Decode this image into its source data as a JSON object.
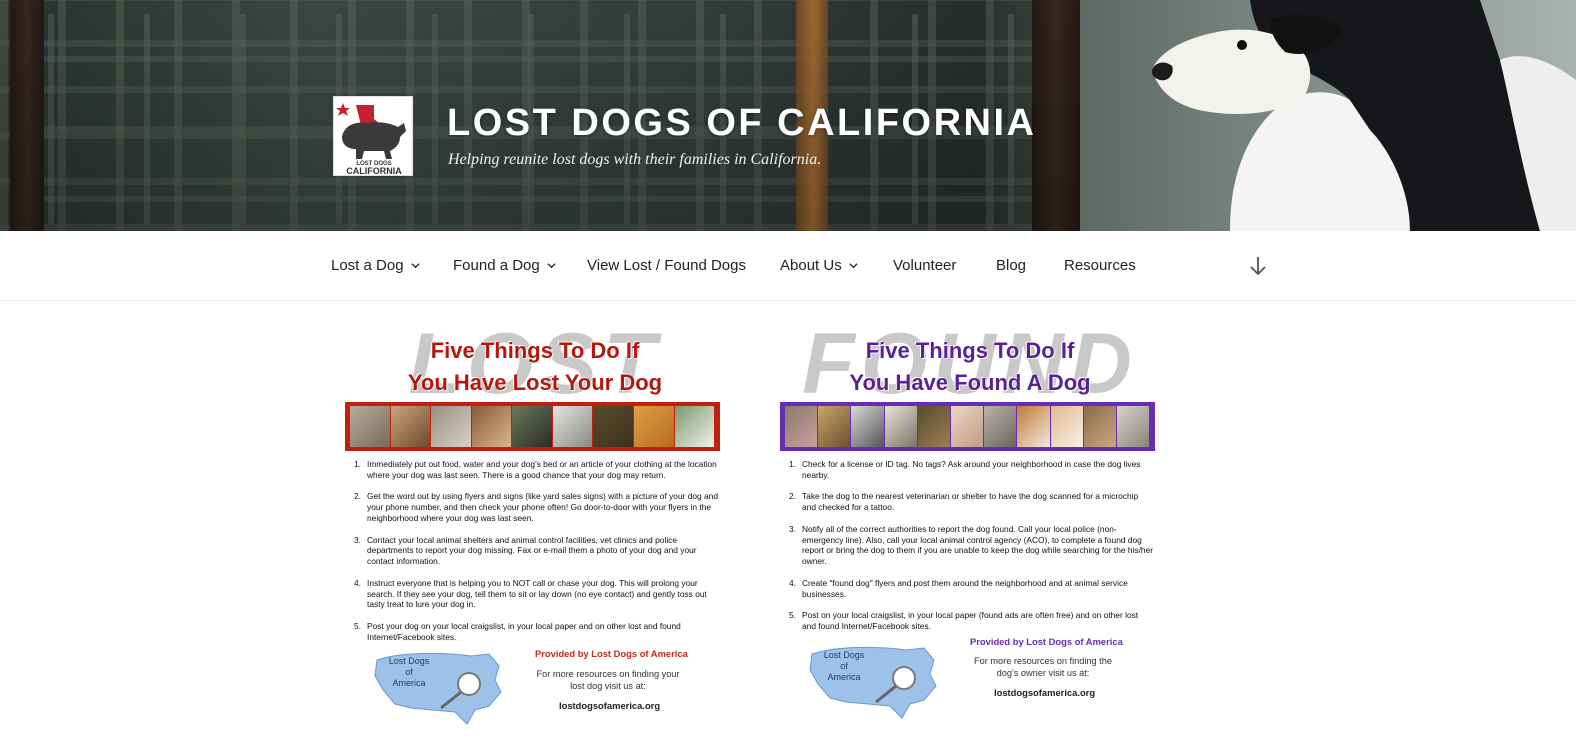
{
  "header": {
    "site_title": "LOST DOGS OF CALIFORNIA",
    "tagline": "Helping reunite lost dogs with their families in California.",
    "logo": {
      "line1": "LOST DOGS",
      "line2": "CALIFORNIA",
      "accent": "#c4202e"
    }
  },
  "nav": {
    "items": [
      {
        "label": "Lost a Dog",
        "has_dropdown": true
      },
      {
        "label": "Found a Dog",
        "has_dropdown": true
      },
      {
        "label": "View Lost / Found Dogs",
        "has_dropdown": false
      },
      {
        "label": "About Us",
        "has_dropdown": true
      },
      {
        "label": "Volunteer",
        "has_dropdown": false
      },
      {
        "label": "Blog",
        "has_dropdown": false
      },
      {
        "label": "Resources",
        "has_dropdown": false
      }
    ],
    "scroll_icon": "arrow-down-icon"
  },
  "flyers": {
    "lost": {
      "bigword": "LOST",
      "title_line1": "Five Things To Do If",
      "title_line2": "You Have Lost Your Dog",
      "color": "#b5170d",
      "frame_color": "#c02010",
      "steps": [
        "Immediately put out food, water and your dog's bed or an article of your clothing at the location where your dog was last seen. There is a good chance that your dog may return.",
        "Get the word out by using flyers and signs (like yard sales signs) with a picture of your dog and your phone number, and then check your phone often! Go door-to-door with your flyers in the neighborhood where your dog was last seen.",
        "Contact your local animal shelters and animal control facilities, vet clinics and police departments to report your dog missing. Fax or e-mail them a photo of your dog and your contact information.",
        "Instruct everyone that is helping you to NOT call or chase your dog. This will prolong your search. If they see your dog, tell them to sit or lay down (no eye contact) and gently toss out tasty treat to lure your dog in.",
        "Post your dog on your local craigslist, in your local paper and on other lost and found Internet/Facebook sites."
      ],
      "map_label": [
        "Lost Dogs",
        "of",
        "America"
      ],
      "provided": "Provided by Lost Dogs of America",
      "more_line1": "For more resources on finding your",
      "more_line2": "lost dog visit us at:",
      "url": "lostdogsofamerica.org"
    },
    "found": {
      "bigword": "FOUND",
      "title_line1": "Five Things To Do If",
      "title_line2": "You Have Found A Dog",
      "color": "#5b1f9a",
      "frame_color": "#6a2cb0",
      "steps": [
        "Check for a license or ID tag.  No tags?  Ask around your neighborhood in case the dog lives nearby.",
        "Take the dog to the nearest veterinarian or shelter to have the dog scanned for a microchip and checked for a tattoo.",
        "Notify all of the correct authorities to report the dog found. Call your local police (non-emergency line).  Also, call your local animal control agency (ACO), to complete a found dog report or bring the dog to them if you are unable to keep the dog while searching for the his/her owner.",
        "Create \"found dog\" flyers and post them around the neighborhood and at animal service businesses.",
        "Post on your local craigslist, in your local paper (found ads are often free) and on other lost and found Internet/Facebook sites."
      ],
      "map_label": [
        "Lost Dogs",
        "of",
        "America"
      ],
      "provided": "Provided by Lost Dogs of America",
      "more_line1": "For more resources on finding the",
      "more_line2": "dog's owner visit us at:",
      "url": "lostdogsofamerica.org"
    }
  }
}
